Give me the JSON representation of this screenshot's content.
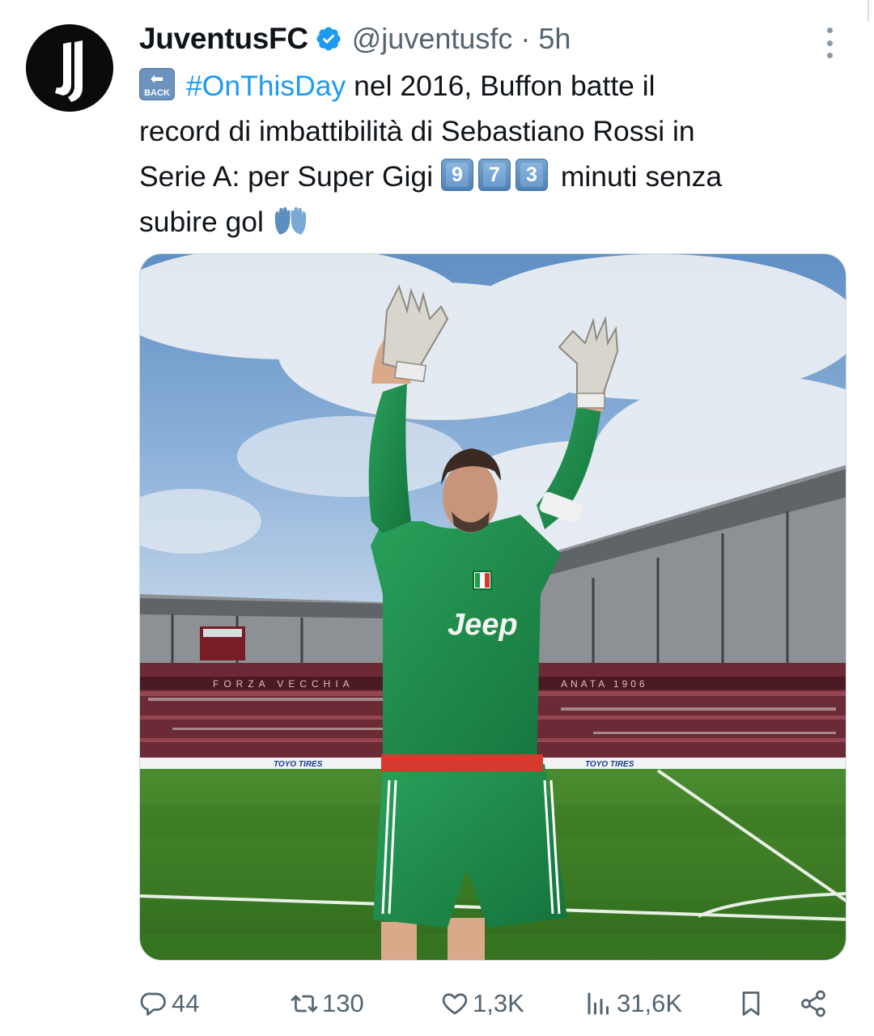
{
  "tweet": {
    "author": {
      "display_name": "JuventusFC",
      "handle": "@juventusfc",
      "verified": true
    },
    "separator": "·",
    "time": "5h",
    "text_lines": [
      "nel 2016, Buffon batte il",
      "record di imbattibilità di Sebastiano Rossi in",
      "Serie A: per Super Gigi",
      "minuti senza",
      "subire gol"
    ],
    "back_emoji_label": "BACK",
    "hashtag": "#OnThisDay",
    "keycap_digits": [
      "9",
      "7",
      "3"
    ],
    "media": {
      "type": "photo",
      "stadium_banners": [
        "FORZA VECCHIA",
        "TOYO TIRES",
        "TOYO TIRES",
        "ANATA 1906"
      ],
      "shirt_sponsor": "Jeep"
    },
    "metrics": {
      "replies": "44",
      "retweets": "130",
      "likes": "1,3K",
      "views": "31,6K"
    }
  },
  "icons": {
    "avatar": "juventus-logo",
    "verified": "verified-badge-icon",
    "more": "more-options-icon",
    "reply": "reply-icon",
    "retweet": "retweet-icon",
    "like": "heart-icon",
    "views": "views-icon",
    "bookmark": "bookmark-icon",
    "share": "share-icon"
  },
  "colors": {
    "text": "#0f1419",
    "secondary": "#536471",
    "link": "#1d9bf0",
    "verified": "#1d9bf0"
  }
}
